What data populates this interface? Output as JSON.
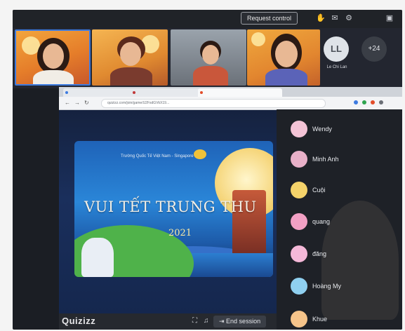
{
  "toolbar": {
    "request_control_label": "Request control",
    "icons": [
      "raise-hand-icon",
      "chat-icon",
      "settings-icon",
      "window-icon"
    ]
  },
  "participants_strip": {
    "tiles": [
      {
        "name": "participant-1",
        "active": true
      },
      {
        "name": "participant-2",
        "active": false
      },
      {
        "name": "participant-3",
        "active": false
      },
      {
        "name": "participant-4",
        "active": false
      }
    ],
    "avatar_initials": "LL",
    "avatar_name": "Le Chi Lan",
    "more_count": "+24"
  },
  "browser": {
    "address": "quizizz.com/join/game/U2FsdGVkX19..."
  },
  "slide": {
    "school": "Trường Quốc Tế Việt Nam - Singapore",
    "title": "VUI TẾT TRUNG THU",
    "year": "2021"
  },
  "session_bar": {
    "brand": "Quizizz",
    "end_label": "End session"
  },
  "participants_list": [
    {
      "name": "Wendy",
      "avatar": "#f3c3d6"
    },
    {
      "name": "Minh Anh",
      "avatar": "#e8b0c8"
    },
    {
      "name": "Cuội",
      "avatar": "#f5d36a"
    },
    {
      "name": "quang",
      "avatar": "#f2a0c4"
    },
    {
      "name": "đăng",
      "avatar": "#f4b8d8"
    },
    {
      "name": "Hoàng My",
      "avatar": "#8fd0f0"
    },
    {
      "name": "Khue",
      "avatar": "#f6c48a"
    }
  ],
  "colors": {
    "active_border": "#3d7be0",
    "panel_bg": "#1e2127"
  }
}
